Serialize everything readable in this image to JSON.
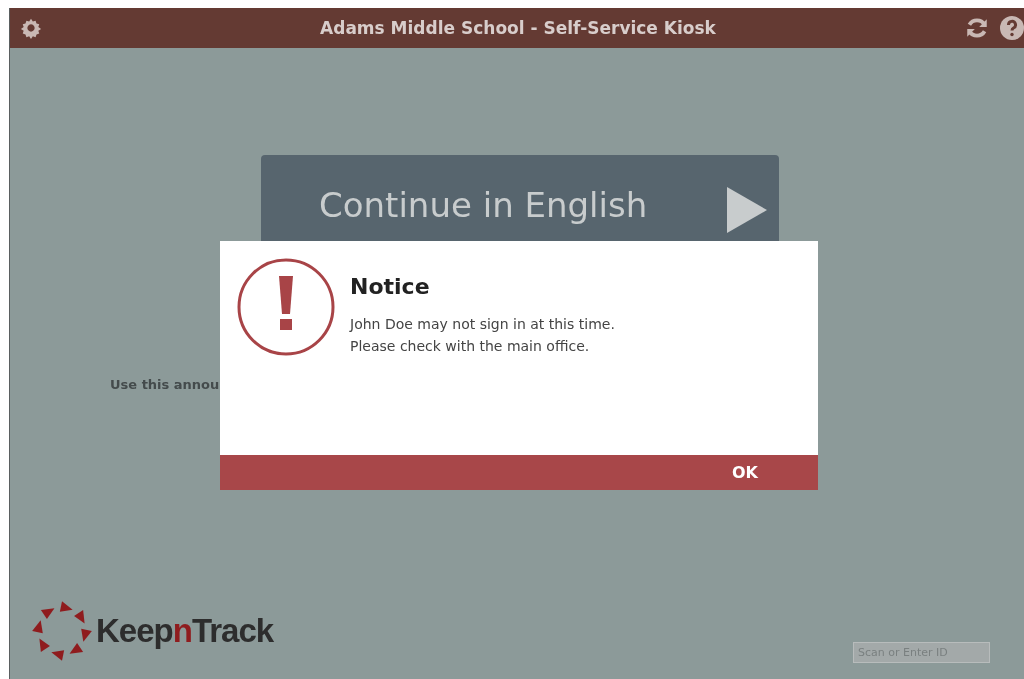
{
  "header": {
    "title": "Adams Middle School - Self-Service Kiosk"
  },
  "continue_button": {
    "label": "Continue in English"
  },
  "announcement": "Use this annou",
  "logo": {
    "parts": [
      {
        "text": "Keep",
        "accent": false
      },
      {
        "text": "n",
        "accent": true
      },
      {
        "text": "Track",
        "accent": false
      }
    ]
  },
  "scan_field": {
    "placeholder": "Scan or Enter ID"
  },
  "dialog": {
    "title": "Notice",
    "lines": [
      "John Doe may not sign in at this time.",
      "Please check with the main office."
    ],
    "button": "OK"
  }
}
